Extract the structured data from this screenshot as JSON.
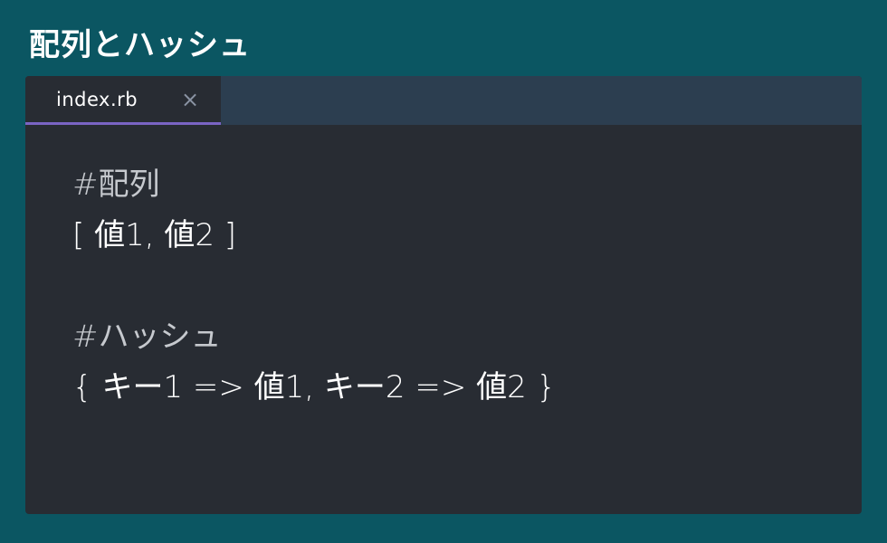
{
  "page": {
    "title": "配列とハッシュ"
  },
  "editor": {
    "tab": {
      "label": "index.rb",
      "close_glyph": "×"
    },
    "lines": [
      {
        "text": "#配列",
        "kind": "comment"
      },
      {
        "text": "[ 値1, 値2 ]",
        "kind": "code"
      },
      {
        "text": "#ハッシュ",
        "kind": "comment"
      },
      {
        "text": "{ キー1 => 値1, キー2 => 値2 }",
        "kind": "code"
      }
    ]
  },
  "colors": {
    "background": "#0b5662",
    "editor_bg": "#282c33",
    "tab_bar_bg": "#2c3e50",
    "tab_accent": "#7a64c4",
    "close_icon": "#8a93a3"
  },
  "icons": {
    "tab_close": "close-icon"
  }
}
